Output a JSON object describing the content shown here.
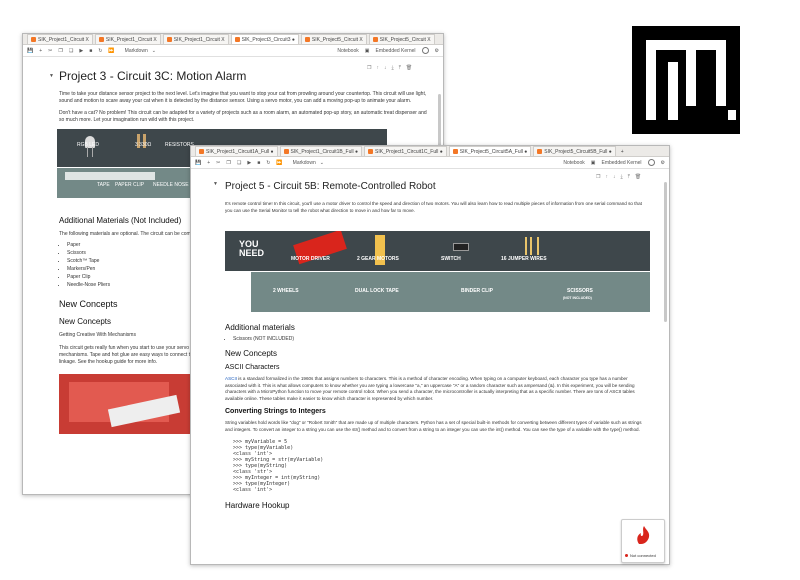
{
  "colors": {
    "accent": "#f37726",
    "banner_dark": "#3e474b",
    "banner_teal": "#738987",
    "brand_red": "#d9251c"
  },
  "window1": {
    "tabs": [
      "SIK_Project1_Circuit X",
      "SIK_Project1_Circuit X",
      "SIK_Project1_Circuit X",
      "SIK_Project3_Circuit3 ●",
      "SIK_Project5_Circuit X",
      "SIK_Project5_Circuit X"
    ],
    "toolbar": {
      "cell_type": "Markdown",
      "notebook": "Notebook",
      "kernel": "Embedded Kernel"
    },
    "title": "Project 3 - Circuit 3C: Motion Alarm",
    "intro": "Time to take your distance sensor project to the next level. Let's imagine that you want to stop your cat from prowling around your countertop. This circuit will use light, sound and motion to scare away your cat when it is detected by the distance sensor. Using a servo motor, you can add a moving pop-up to animate your alarm.",
    "intro2": "Don't have a cat? No problem! This circuit can be adapted for a variety of projects such as a room alarm, an automated pop-up story, an automatic treat dispenser and so much more. Let your imagination run wild with this project.",
    "banner_labels": [
      "RGB LED",
      "3 330Ω",
      "RESISTORS"
    ],
    "banner2_labels": [
      "TAPE",
      "PAPER CLIP",
      "NEEDLE NOSE PLIERS"
    ],
    "additional_title": "Additional Materials (Not Included)",
    "additional_text": "The following materials are optional. The circuit can be completed without them.",
    "materials": [
      "Paper",
      "Scissors",
      "Scotch™ Tape",
      "Markers/Pen",
      "Paper Clip",
      "Needle-Nose Pliers"
    ],
    "new_concepts": "New Concepts",
    "new_concepts_sub": "New Concepts",
    "getting_creative": "Getting Creative With Mechanisms",
    "creative_text": "This circuit gets really fun when you start to use your servo to animate the world around you. To do this, you'll need to connect your servo to some physical mechanisms. Tape and hot glue are easy ways to connect things to your servo. You can also loop a paper clip through the small holes in the servo arm to serve as a linkage. See the hookup guide for more info."
  },
  "window2": {
    "tabs": [
      "SIK_Project1_Circuit1A_Full ●",
      "SIK_Project1_Circuit1B_Full ●",
      "SIK_Project1_Circuit1C_Full ●",
      "SIK_Project5_Circuit5A_Full ●",
      "SIK_Project5_Circuit5B_Full ●"
    ],
    "toolbar": {
      "cell_type": "Markdown",
      "notebook": "Notebook",
      "kernel": "Embedded Kernel"
    },
    "title": "Project 5 - Circuit 5B: Remote-Controlled Robot",
    "intro": "It's remote control time! In this circuit, you'll use a motor driver to control the speed and direction of two motors. You will also learn how to read multiple pieces of information from one serial command so that you can use the Serial Monitor to tell the robot what direction to move in and how far to move.",
    "you_need": "YOU NEED",
    "parts": [
      "MOTOR DRIVER",
      "2 GEAR MOTORS",
      "SWITCH",
      "16 JUMPER WIRES"
    ],
    "parts2": [
      "2 WHEELS",
      "DUAL LOCK TAPE",
      "BINDER CLIP",
      "SCISSORS"
    ],
    "not_included": "(NOT INCLUDED)",
    "additional_title": "Additional materials",
    "additional_items": [
      "Scissors (NOT INCLUDED)"
    ],
    "new_concepts": "New Concepts",
    "ascii_title": "ASCII Characters",
    "ascii_link": "ASCII",
    "ascii_text": " is a standard formalized in the 1960s that assigns numbers to characters. This is a method of character encoding. When typing on a computer keyboard, each character you type has a number associated with it. This is what allows computers to know whether you are typing a lowercase \"a,\" an uppercase \"A\" or a random character such as ampersand (&). In this experiment, you will be sending characters with a MicroPython function to move your remote control robot. When you send a character, the microcontroller is actually interpreting that as a specific number. There are tons of ASCII tables available online. These tables make it easier to know which character is represented by which number.",
    "converting_title": "Converting Strings to Integers",
    "converting_text": "String variables hold words like \"dog\" or \"Robert Smith\" that are made up of multiple characters. Python has a set of special built-in methods for converting between different types of variable such as strings and integers. To convert an integer to a string you can use the str() method and to convert from a string to an integer you can use the int() method. You can see the type of a variable with the type() method.",
    "code": ">>> myVariable = 5\n>>> type(myVariable)\n<class 'int'>\n>>> myString = str(myVariable)\n>>> type(myString)\n<class 'str'>\n>>> myInteger = int(myString)\n>>> type(myInteger)\n<class 'int'>",
    "hardware_hookup": "Hardware Hookup"
  },
  "status_badge": {
    "text": "Not connected"
  }
}
